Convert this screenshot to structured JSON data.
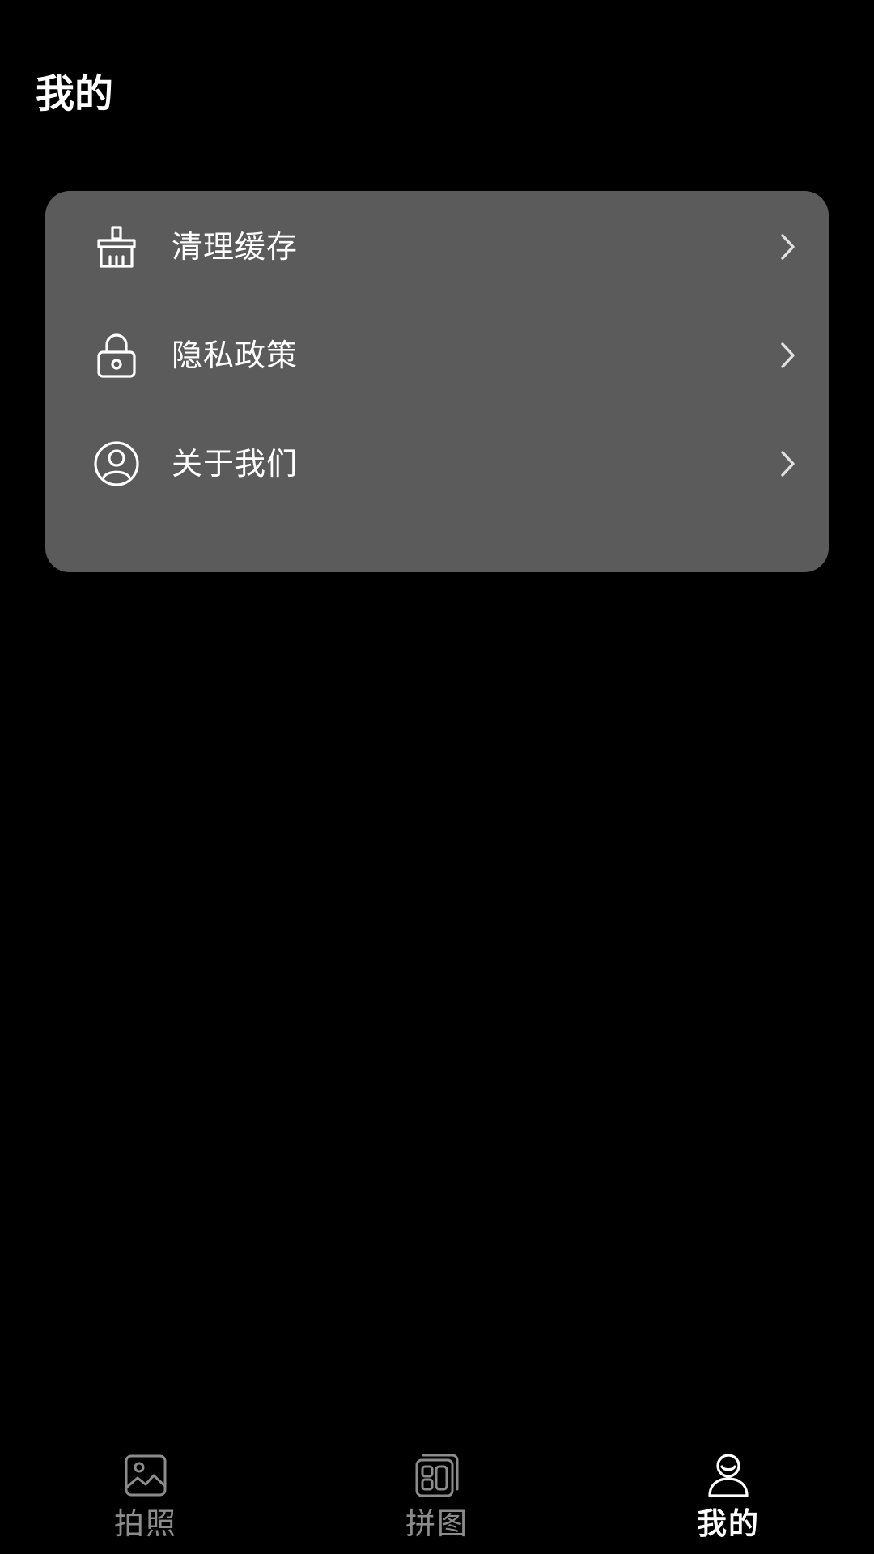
{
  "header": {
    "title": "我的"
  },
  "menu": {
    "items": [
      {
        "label": "清理缓存",
        "icon": "broom-icon"
      },
      {
        "label": "隐私政策",
        "icon": "lock-icon"
      },
      {
        "label": "关于我们",
        "icon": "user-circle-icon"
      }
    ],
    "chevron_icon": "chevron-right-icon"
  },
  "bottom_nav": {
    "items": [
      {
        "label": "拍照",
        "icon": "image-icon",
        "active": false
      },
      {
        "label": "拼图",
        "icon": "collage-icon",
        "active": false
      },
      {
        "label": "我的",
        "icon": "person-icon",
        "active": true
      }
    ]
  },
  "colors": {
    "background": "#000000",
    "card": "#5b5b5b",
    "text_primary": "#ffffff",
    "text_inactive": "#8c8c8c"
  }
}
